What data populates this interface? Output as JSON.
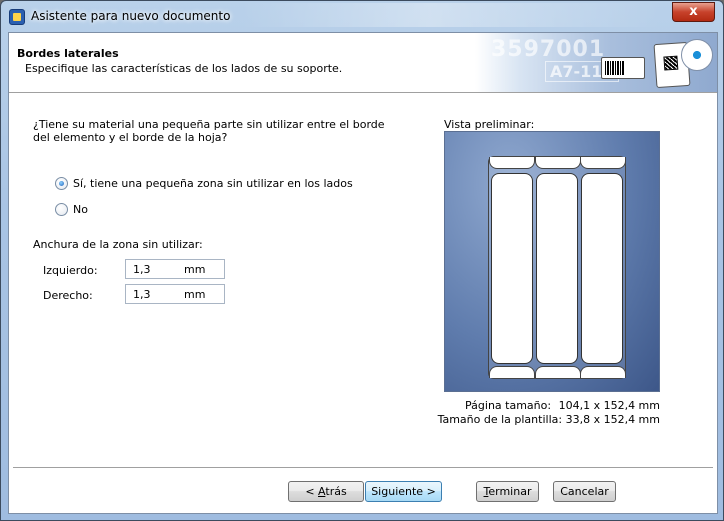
{
  "window": {
    "title": "Asistente para nuevo documento",
    "close_label": "x"
  },
  "header": {
    "title": "Bordes laterales",
    "subtitle": "Especifique las características de los lados de su soporte.",
    "banner_digits": "3597001",
    "banner_code": "A7-118"
  },
  "form": {
    "question": "¿Tiene su material una pequeña parte sin utilizar entre el borde del elemento y el borde de la hoja?",
    "options": [
      {
        "label": "Sí, tiene una pequeña zona sin utilizar en los lados",
        "selected": true
      },
      {
        "label": "No",
        "selected": false
      }
    ],
    "width_label": "Anchura de la zona sin utilizar:",
    "left": {
      "label": "Izquierdo:",
      "value": "1,3",
      "unit": "mm"
    },
    "right": {
      "label": "Derecho:",
      "value": "1,3",
      "unit": "mm"
    }
  },
  "preview": {
    "label": "Vista preliminar:",
    "page_size_label": "Página tamaño:",
    "page_size_value": "104,1 x 152,4 mm",
    "template_size_label": "Tamaño de la plantilla:",
    "template_size_value": "33,8 x 152,4 mm",
    "columns": 3
  },
  "buttons": {
    "back_prefix": "< ",
    "back_key": "A",
    "back_rest": "trás",
    "next": "Siguiente >",
    "finish_key": "T",
    "finish_rest": "erminar",
    "cancel": "Cancelar"
  },
  "colors": {
    "preview_bg": "#5f7cad",
    "close_button": "#c7422b",
    "title_bar": "#b9d1ea"
  }
}
